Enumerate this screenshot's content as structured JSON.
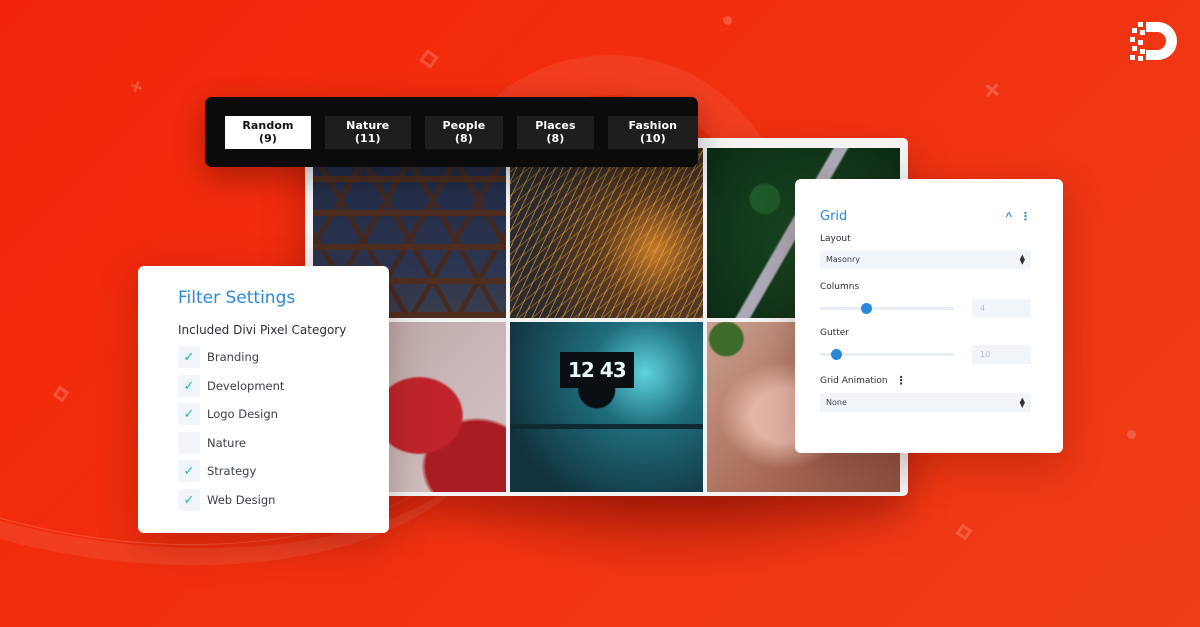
{
  "colors": {
    "background": "#f1300f",
    "accent_blue": "#2b87da",
    "check_teal": "#1fb9a2",
    "filter_bar_bg": "#0b0b0b",
    "filter_btn_bg": "#1e1e1e"
  },
  "logo": {
    "icon": "divi-pixel-d-logo"
  },
  "filter_bar": {
    "buttons": [
      {
        "label": "Random",
        "count": "(9)",
        "text": "Random  (9)",
        "active": true
      },
      {
        "label": "Nature",
        "count": "(11)",
        "text": "Nature  (11)",
        "active": false
      },
      {
        "label": "People",
        "count": "(8)",
        "text": "People  (8)",
        "active": false
      },
      {
        "label": "Places",
        "count": "(8)",
        "text": "Places  (8)",
        "active": false
      },
      {
        "label": "Fashion",
        "count": "(10)",
        "text": "Fashion  (10)",
        "active": false
      }
    ]
  },
  "gallery": {
    "photos": [
      {
        "subject": "hexagonal-architecture"
      },
      {
        "subject": "angle-grinder-sparks"
      },
      {
        "subject": "aerial-road-forest"
      },
      {
        "subject": "strawberries"
      },
      {
        "subject": "desk-setup-clock",
        "clock_text": "12 43"
      },
      {
        "subject": "pink-fabric"
      }
    ]
  },
  "filter_settings": {
    "title": "Filter Settings",
    "section_label": "Included Divi Pixel Category",
    "check_glyph": "✓",
    "categories": [
      {
        "label": "Branding",
        "checked": true
      },
      {
        "label": "Development",
        "checked": true
      },
      {
        "label": "Logo Design",
        "checked": true
      },
      {
        "label": "Nature",
        "checked": false
      },
      {
        "label": "Strategy",
        "checked": true
      },
      {
        "label": "Web Design",
        "checked": true
      }
    ]
  },
  "grid_settings": {
    "title": "Grid",
    "collapse_icon": "^",
    "menu_icon": "⋮",
    "layout": {
      "label": "Layout",
      "value": "Masonry"
    },
    "columns": {
      "label": "Columns",
      "value": "4",
      "slider_fraction": 0.34
    },
    "gutter": {
      "label": "Gutter",
      "value": "10",
      "slider_fraction": 0.12
    },
    "grid_animation": {
      "label": "Grid Animation",
      "value": "None"
    }
  }
}
